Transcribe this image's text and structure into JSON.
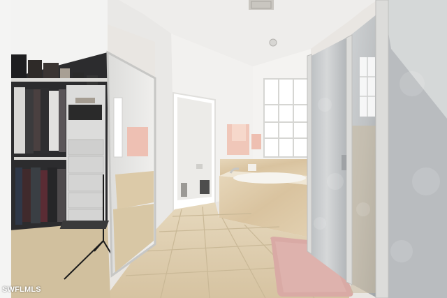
{
  "image": {
    "watermark": "SWFLMLS"
  },
  "colors": {
    "wall": "#f1f0ee",
    "ceiling": "#efeeec",
    "floor_tile": "#dccbad",
    "floor_grout": "#c9b896",
    "marble": "#dcc8a6",
    "glass": "#c9ccce",
    "frame": "#d8d8d6",
    "towel": "#efc3b6",
    "bath_mat": "#d8a8a4",
    "closet_dark": "#2a2a2c",
    "drawer_unit": "#d9d9d9"
  }
}
